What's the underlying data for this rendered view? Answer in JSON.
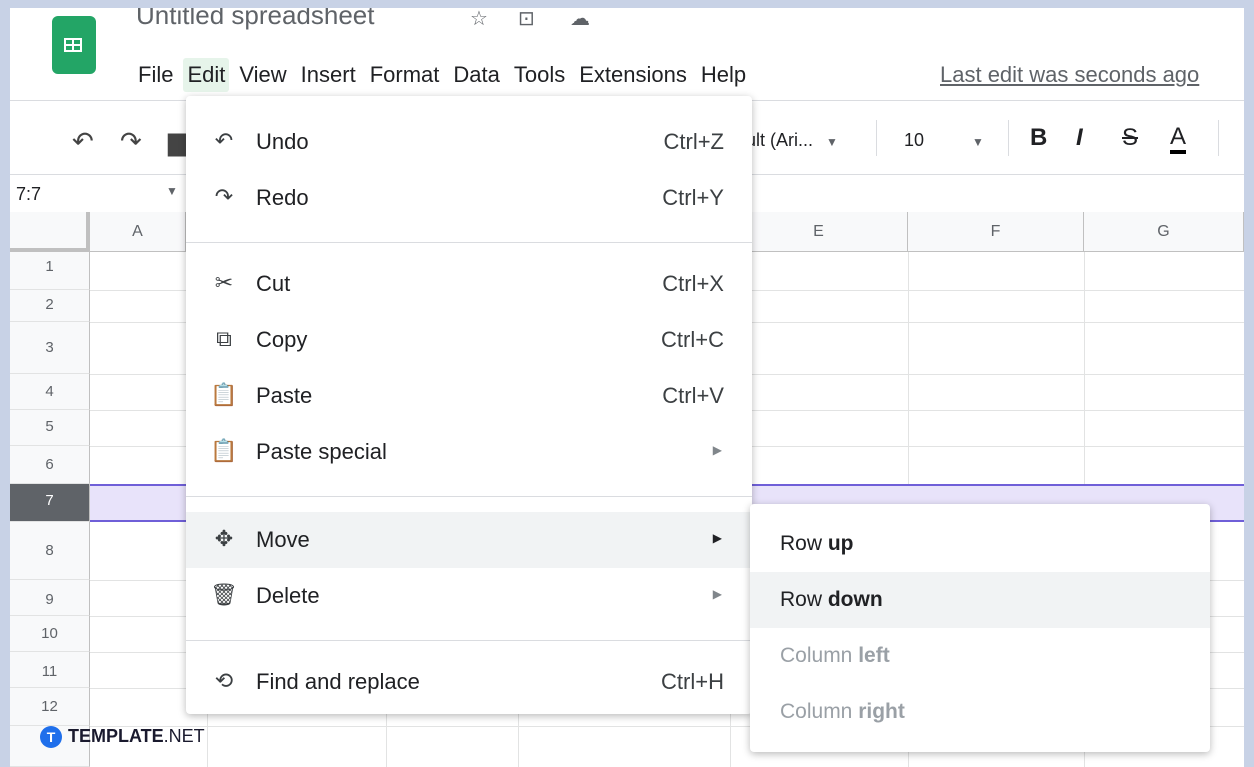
{
  "app": {
    "title": "Untitled spreadsheet",
    "title_icons": [
      "star-icon",
      "move-to-folder-icon",
      "cloud-status-icon"
    ],
    "last_edit": "Last edit was seconds ago"
  },
  "menubar": [
    "File",
    "Edit",
    "View",
    "Insert",
    "Format",
    "Data",
    "Tools",
    "Extensions",
    "Help"
  ],
  "toolbar": {
    "font_name": "ult (Ari...",
    "font_size": "10",
    "bold": "B",
    "italic": "I",
    "strike": "S",
    "text_color": "A"
  },
  "name_box": "7:7",
  "grid": {
    "columns": [
      "A",
      "E",
      "F",
      "G"
    ],
    "rows": [
      "1",
      "2",
      "3",
      "4",
      "5",
      "6",
      "7",
      "8",
      "9",
      "10",
      "11",
      "12"
    ],
    "selected_row": "7"
  },
  "edit_menu": {
    "items": [
      {
        "label": "Undo",
        "shortcut": "Ctrl+Z",
        "icon": "undo-icon"
      },
      {
        "label": "Redo",
        "shortcut": "Ctrl+Y",
        "icon": "redo-icon"
      },
      {
        "label": "Cut",
        "shortcut": "Ctrl+X",
        "icon": "scissors-icon"
      },
      {
        "label": "Copy",
        "shortcut": "Ctrl+C",
        "icon": "copy-icon"
      },
      {
        "label": "Paste",
        "shortcut": "Ctrl+V",
        "icon": "clipboard-icon"
      },
      {
        "label": "Paste special",
        "shortcut": "",
        "icon": "clipboard-icon"
      },
      {
        "label": "Move",
        "shortcut": "",
        "icon": "move-icon"
      },
      {
        "label": "Delete",
        "shortcut": "",
        "icon": "trash-icon"
      },
      {
        "label": "Find and replace",
        "shortcut": "Ctrl+H",
        "icon": "find-replace-icon"
      }
    ]
  },
  "move_submenu": {
    "items": [
      {
        "prefix": "Row ",
        "bold": "up",
        "enabled": true
      },
      {
        "prefix": "Row ",
        "bold": "down",
        "enabled": true
      },
      {
        "prefix": "Column ",
        "bold": "left",
        "enabled": false
      },
      {
        "prefix": "Column ",
        "bold": "right",
        "enabled": false
      }
    ]
  },
  "watermark": {
    "brand": "TEMPLATE",
    "suffix": ".NET"
  },
  "colors": {
    "sheets_green": "#23a566",
    "selection": "#6f5fd8",
    "selection_fill": "#e8e3fa"
  }
}
